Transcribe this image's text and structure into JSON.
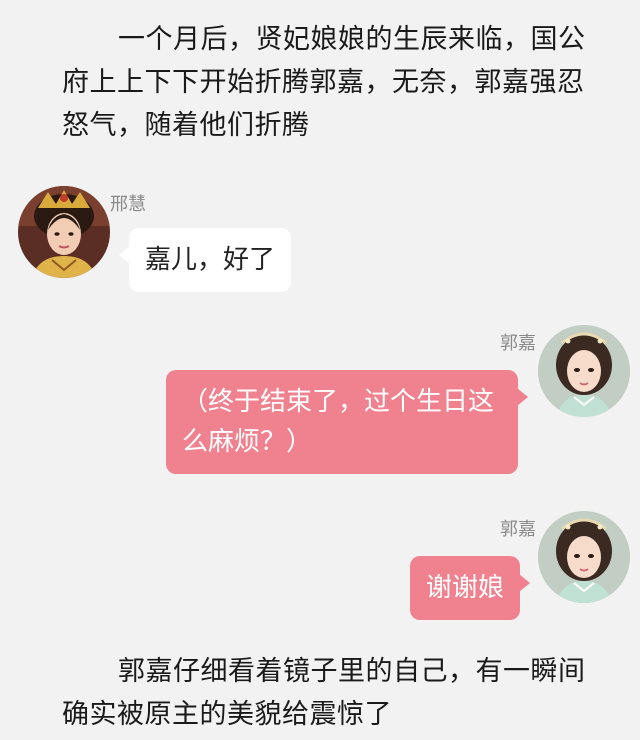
{
  "narration": {
    "top": "一个月后，贤妃娘娘的生辰来临，国公府上上下下开始折腾郭嘉，无奈，郭嘉强忍怒气，随着他们折腾",
    "bottom": "郭嘉仔细看着镜子里的自己，有一瞬间确实被原主的美貌给震惊了"
  },
  "messages": [
    {
      "speaker": "邢慧",
      "text": "嘉儿，好了",
      "side": "left"
    },
    {
      "speaker": "郭嘉",
      "text": "（终于结束了，过个生日这么麻烦？）",
      "side": "right"
    },
    {
      "speaker": "郭嘉",
      "text": "谢谢娘",
      "side": "right"
    }
  ],
  "colors": {
    "background": "#f2f2f2",
    "bubble_left": "#ffffff",
    "bubble_right": "#f0828f",
    "speaker_name": "#8a8a8a"
  }
}
